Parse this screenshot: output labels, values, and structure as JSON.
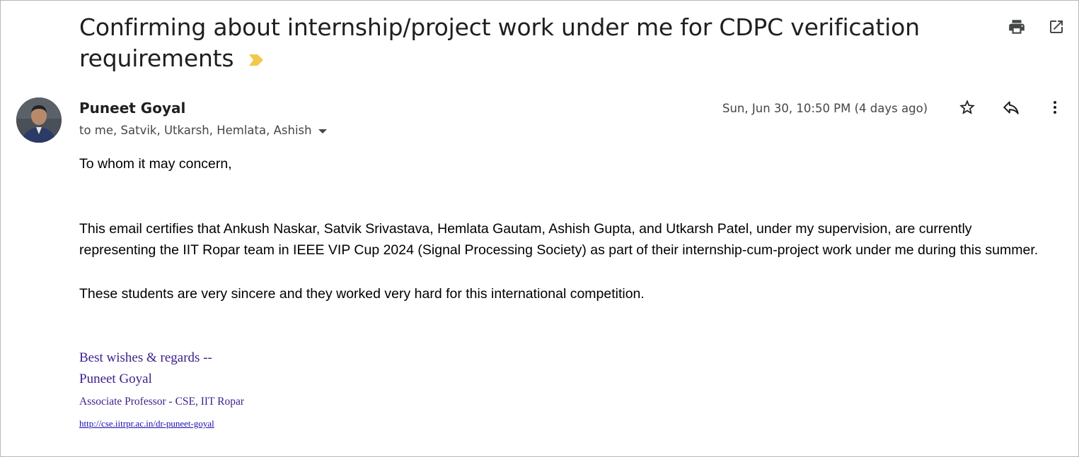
{
  "email": {
    "subject": "Confirming about internship/project work under me for CDPC verification requirements",
    "sender_name": "Puneet Goyal",
    "recipients": "to me, Satvik, Utkarsh, Hemlata, Ashish",
    "date": "Sun, Jun 30, 10:50 PM (4 days ago)",
    "body": {
      "greeting": "To whom it may concern,",
      "paragraph1": "This email certifies that Ankush Naskar, Satvik Srivastava, Hemlata Gautam, Ashish Gupta, and Utkarsh Patel, under my supervision, are currently representing the IIT Ropar team in IEEE VIP Cup 2024 (Signal Processing Society) as part of their internship-cum-project work under me during this summer.",
      "paragraph2": "These students are very sincere and they worked very hard for this international competition."
    },
    "signature": {
      "line1": "Best wishes & regards --",
      "line2": "Puneet Goyal",
      "line3": "Associate Professor - CSE, IIT Ropar",
      "link": "http://cse.iitrpr.ac.in/dr-puneet-goyal"
    }
  },
  "icons": {
    "importance": "importance-marker-icon",
    "print": "print-icon",
    "open_new_window": "open-in-new-window-icon",
    "star": "star-icon",
    "reply": "reply-icon",
    "more": "more-vertical-icon",
    "recipient_details": "chevron-down-icon"
  },
  "colors": {
    "importance_marker": "#f2c94c",
    "signature_text": "#3d1e8a",
    "link": "#1a0dab"
  }
}
